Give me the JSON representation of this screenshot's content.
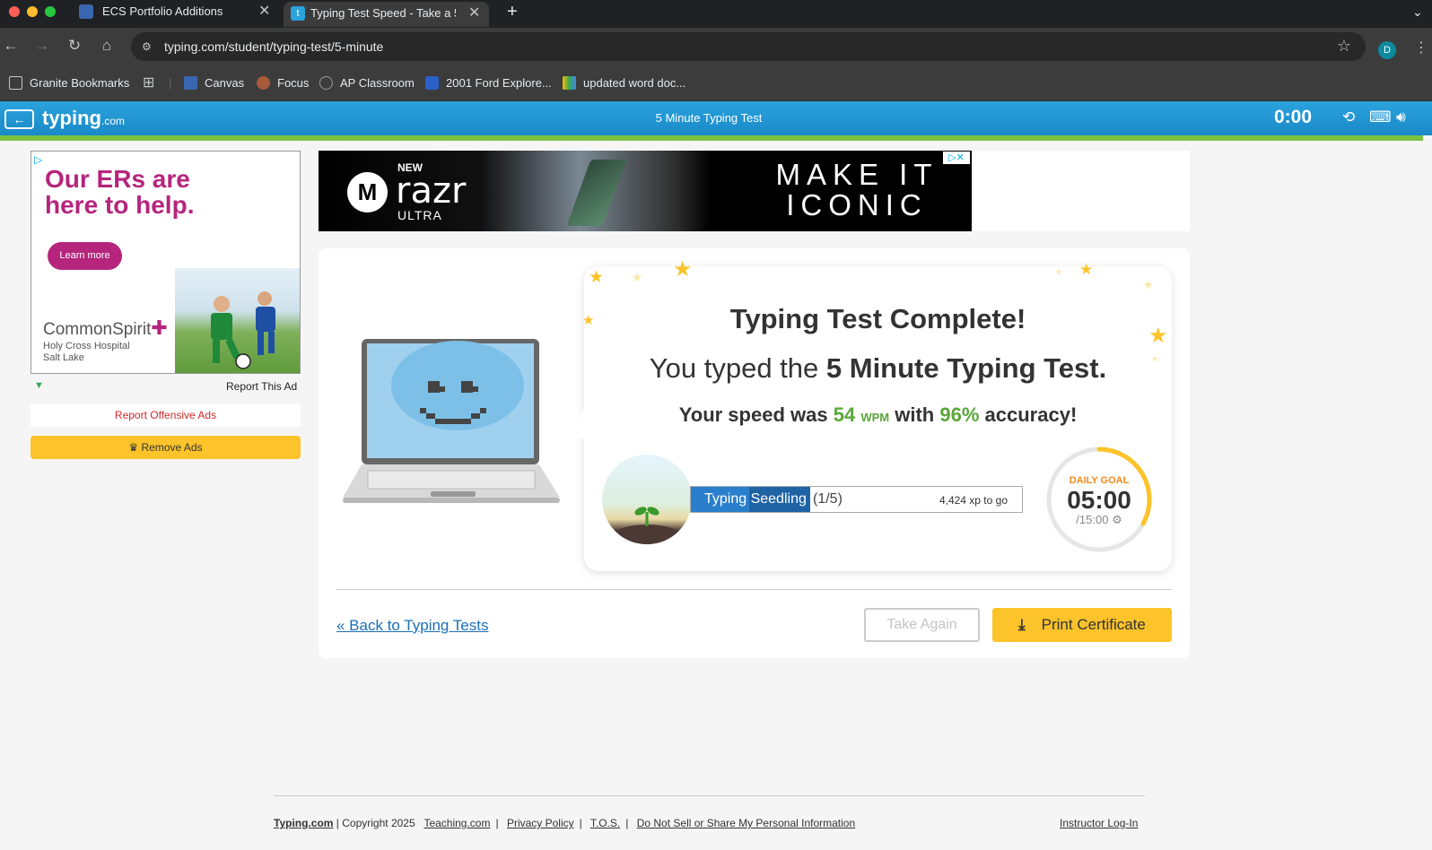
{
  "browser": {
    "tabs": [
      {
        "title": "ECS Portfolio Additions",
        "active": false
      },
      {
        "title": "Typing Test Speed - Take a 5",
        "active": true
      }
    ],
    "new_tab": "+",
    "url": "typing.com/student/typing-test/5-minute",
    "profile_initial": "D",
    "bookmarks": [
      {
        "label": "Granite Bookmarks",
        "icon": "folder-icon"
      },
      {
        "label": "Canvas",
        "icon": "canvas-icon"
      },
      {
        "label": "Focus",
        "icon": "focus-icon"
      },
      {
        "label": "AP Classroom",
        "icon": "ap-icon"
      },
      {
        "label": "2001 Ford Explore...",
        "icon": "ford-icon"
      },
      {
        "label": "updated word doc...",
        "icon": "drive-icon"
      }
    ]
  },
  "header": {
    "logo": "typing",
    "logo_suffix": ".com",
    "page_title": "5 Minute Typing Test",
    "timer": "0:00"
  },
  "ads": {
    "side": {
      "headline": "Our ERs are here to help.",
      "cta": "Learn more",
      "brand": "CommonSpirit",
      "sub_line1": "Holy Cross Hospital",
      "sub_line2": "Salt Lake"
    },
    "report_this_ad": "Report This Ad",
    "report_offensive": "Report Offensive Ads",
    "remove_ads": "Remove Ads",
    "banner": {
      "new": "NEW",
      "product": "razr",
      "variant": "ULTRA",
      "slogan_line1": "MAKE IT",
      "slogan_line2": "ICONIC"
    }
  },
  "result": {
    "title": "Typing Test Complete!",
    "sub_prefix": "You typed the",
    "test_name": "5 Minute Typing Test.",
    "speed_prefix": "Your speed was",
    "wpm": "54",
    "wpm_unit": "WPM",
    "with": "with",
    "accuracy": "96%",
    "accuracy_suffix": "accuracy!",
    "level_name": "Typing Seedling",
    "level_progress": "(1/5)",
    "xp_to_go": "4,424 xp to go",
    "xp_fraction": 0.36,
    "daily_goal_label": "DAILY GOAL",
    "daily_goal_time": "05:00",
    "daily_goal_max": "/15:00",
    "daily_goal_fraction": 0.33
  },
  "actions": {
    "back_link": "« Back to Typing Tests",
    "take_again": "Take Again",
    "print_certificate": "Print Certificate"
  },
  "footer": {
    "brand": "Typing.com",
    "copyright": "| Copyright 2025",
    "teaching": "Teaching.com",
    "privacy": "Privacy Policy",
    "tos": "T.O.S.",
    "do_not_sell": "Do Not Sell or Share My Personal Information",
    "instructor": "Instructor Log-In"
  },
  "colors": {
    "accent_blue": "#1a89c7",
    "accent_green": "#5aa639",
    "accent_yellow": "#fcc32a",
    "link_blue": "#1a6fb7"
  }
}
